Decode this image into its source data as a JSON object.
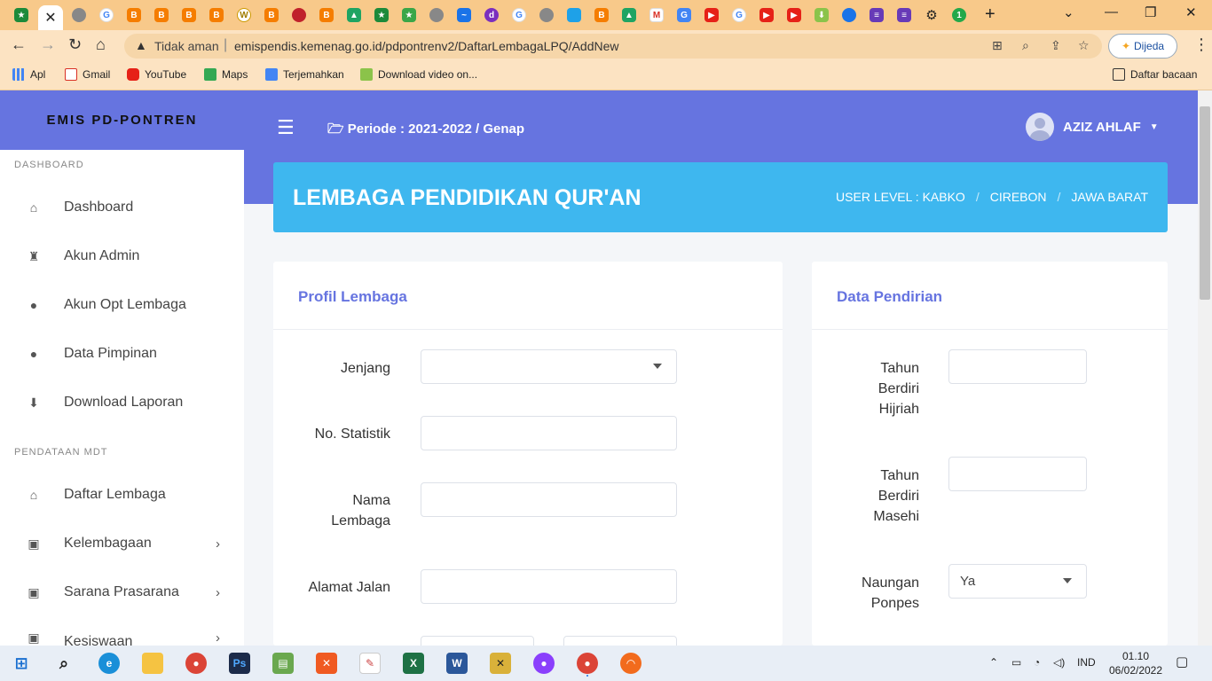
{
  "browser": {
    "address": {
      "security_label": "Tidak aman",
      "url": "emispendis.kemenag.go.id/pdpontrenv2/DaftarLembagaLPQ/AddNew"
    },
    "profile_button": "Dijeda",
    "bookmarks": [
      "Apl",
      "Gmail",
      "YouTube",
      "Maps",
      "Terjemahkan",
      "Download video on..."
    ],
    "reading_list": "Daftar bacaan"
  },
  "app": {
    "brand": "EMIS PD-PONTREN",
    "periode": "Periode : 2021-2022 / Genap",
    "user_name": "AZIZ AHLAF",
    "sidebar": {
      "section_dashboard": "DASHBOARD",
      "section_pendataan": "PENDATAAN MDT",
      "items": [
        {
          "label": "Dashboard"
        },
        {
          "label": "Akun Admin"
        },
        {
          "label": "Akun Opt Lembaga"
        },
        {
          "label": "Data Pimpinan"
        },
        {
          "label": "Download Laporan"
        },
        {
          "label": "Daftar Lembaga"
        },
        {
          "label": "Kelembagaan"
        },
        {
          "label": "Sarana Prasarana"
        },
        {
          "label": "Kesiswaan"
        }
      ]
    },
    "page_title": "LEMBAGA PENDIDIKAN QUR'AN",
    "breadcrumb": [
      "USER LEVEL : KABKO",
      "CIREBON",
      "JAWA BARAT"
    ],
    "profil": {
      "title": "Profil Lembaga",
      "jenjang_label": "Jenjang",
      "jenjang_value": "",
      "statistik_label": "No. Statistik",
      "statistik_value": "",
      "nama_label_1": "Nama",
      "nama_label_2": "Lembaga",
      "nama_value": "",
      "alamat_label": "Alamat Jalan",
      "alamat_value": ""
    },
    "pendirian": {
      "title": "Data Pendirian",
      "hijriah_label": [
        "Tahun",
        "Berdiri",
        "Hijriah"
      ],
      "hijriah_value": "",
      "masehi_label": [
        "Tahun",
        "Berdiri",
        "Masehi"
      ],
      "masehi_value": "",
      "naungan_label": [
        "Naungan",
        "Ponpes"
      ],
      "naungan_value": "Ya"
    }
  },
  "taskbar": {
    "language": "IND",
    "time": "01.10",
    "date": "06/02/2022"
  }
}
